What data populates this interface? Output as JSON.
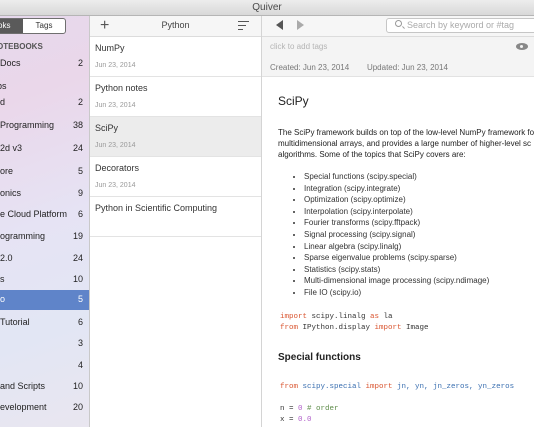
{
  "window": {
    "title": "Quiver"
  },
  "sidebar": {
    "segments": [
      "ooks",
      "Tags"
    ],
    "notebooks_header": "OTEBOOKS",
    "lib_header": "bs",
    "notebooks": [
      {
        "label": "Docs",
        "count": "2"
      },
      {
        "label": "d",
        "count": "2"
      },
      {
        "label": " Programming",
        "count": "38"
      },
      {
        "label": "2d v3",
        "count": "24"
      },
      {
        "label": "ore",
        "count": "5"
      },
      {
        "label": "onics",
        "count": "9"
      },
      {
        "label": "e Cloud Platform",
        "count": "6"
      },
      {
        "label": "ogramming",
        "count": "19"
      },
      {
        "label": "2.0",
        "count": "24"
      },
      {
        "label": "s",
        "count": "10"
      },
      {
        "label": "o",
        "count": "5"
      },
      {
        "label": "Tutorial",
        "count": "6"
      },
      {
        "label": "",
        "count": "3"
      },
      {
        "label": "",
        "count": "4"
      },
      {
        "label": "and Scripts",
        "count": "10"
      },
      {
        "label": "evelopment",
        "count": "20"
      }
    ]
  },
  "notelist": {
    "title": "Python",
    "notes": [
      {
        "title": "NumPy",
        "date": "Jun 23, 2014"
      },
      {
        "title": "Python notes",
        "date": "Jun 23, 2014"
      },
      {
        "title": "SciPy",
        "date": "Jun 23, 2014"
      },
      {
        "title": "Decorators",
        "date": "Jun 23, 2014"
      },
      {
        "title": "Python in Scientific Computing",
        "date": ""
      }
    ]
  },
  "editor": {
    "search_placeholder": "Search by keyword or #tag",
    "tags_placeholder": "click to add tags",
    "created": "Created: Jun 23, 2014",
    "updated": "Updated: Jun 23, 2014",
    "heading": "SciPy",
    "paragraph": [
      "The SciPy framework builds on top of the low-level NumPy framework fo",
      "multidimensional arrays, and provides a large number of higher-level sc",
      "algorithms. Some of the topics that SciPy covers are:"
    ],
    "bullets": [
      "Special functions (scipy.special)",
      "Integration (scipy.integrate)",
      "Optimization (scipy.optimize)",
      "Interpolation (scipy.interpolate)",
      "Fourier transforms (scipy.fftpack)",
      "Signal processing (scipy.signal)",
      "Linear algebra (scipy.linalg)",
      "Sparse eigenvalue problems (scipy.sparse)",
      "Statistics (scipy.stats)",
      "Multi-dimensional image processing (scipy.ndimage)",
      "File IO (scipy.io)"
    ],
    "code1": {
      "l1_kw1": "import",
      "l1_mod": " scipy.linalg ",
      "l1_kw2": "as",
      "l1_alias": " la",
      "l2_kw1": "from",
      "l2_mod": " IPython.display ",
      "l2_kw2": "import",
      "l2_name": " Image"
    },
    "subheading": "Special functions",
    "code2": {
      "l1_kw1": "from",
      "l1_mod": " scipy.special ",
      "l1_kw2": "import",
      "l1_names": " jn, yn, jn_zeros, yn_zeros",
      "l2_var": "n = ",
      "l2_num": "0",
      "l2_cm": " # order",
      "l3_var": "x = ",
      "l3_num": "0.0"
    }
  }
}
